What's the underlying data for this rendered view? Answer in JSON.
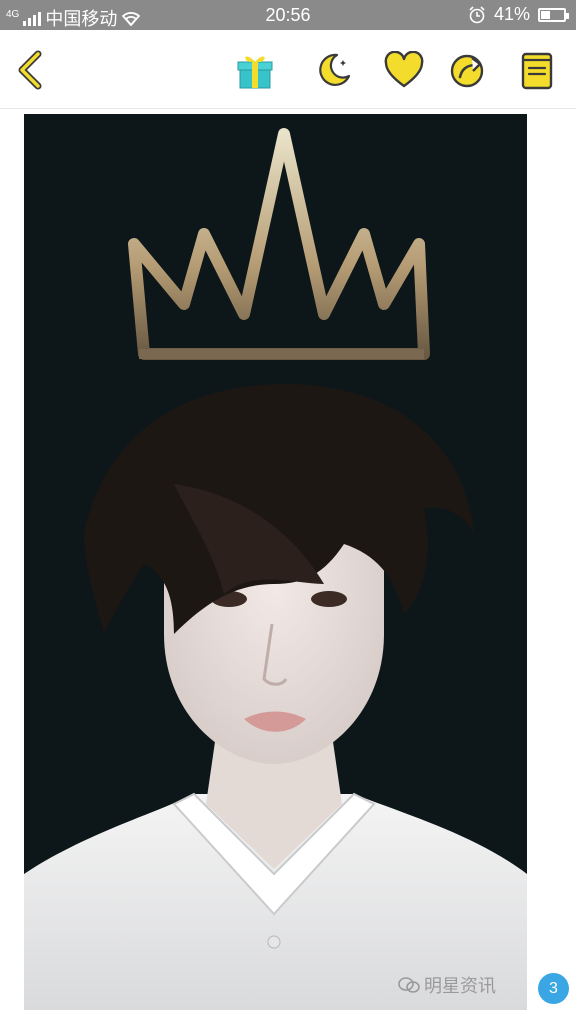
{
  "status_bar": {
    "network": "4G",
    "carrier": "中国移动",
    "time": "20:56",
    "battery_percent": "41%",
    "battery_level": 0.41,
    "icons": [
      "signal-icon",
      "wifi-icon",
      "alarm-icon",
      "battery-icon"
    ]
  },
  "toolbar": {
    "accent_color": "#f3dc2b",
    "buttons": [
      "back-arrow-icon",
      "gift-icon",
      "night-mode-icon",
      "favorite-heart-icon",
      "share-icon",
      "book-icon"
    ]
  },
  "image": {
    "description_icon": "portrait-image",
    "watermark": "明星资讯"
  },
  "badge": {
    "count": "3",
    "color": "#3aa7e4"
  }
}
